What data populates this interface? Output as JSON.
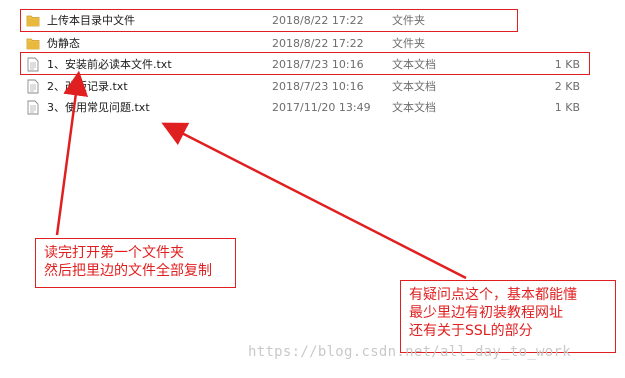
{
  "files": [
    {
      "name": "上传本目录中文件",
      "date": "2018/8/22 17:22",
      "type": "文件夹",
      "size": "",
      "icon": "folder-icon"
    },
    {
      "name": "伪静态",
      "date": "2018/8/22 17:22",
      "type": "文件夹",
      "size": "",
      "icon": "folder-icon"
    },
    {
      "name": "1、安装前必读本文件.txt",
      "date": "2018/7/23 10:16",
      "type": "文本文档",
      "size": "1 KB",
      "icon": "text-file-icon"
    },
    {
      "name": "2、改版记录.txt",
      "date": "2018/7/23 10:16",
      "type": "文本文档",
      "size": "2 KB",
      "icon": "text-file-icon"
    },
    {
      "name": "3、使用常见问题.txt",
      "date": "2017/11/20 13:49",
      "type": "文本文档",
      "size": "1 KB",
      "icon": "text-file-icon"
    }
  ],
  "annotations": {
    "note_left": {
      "line1": "读完打开第一个文件夹",
      "line2": "然后把里边的文件全部复制"
    },
    "note_right": {
      "line1": "有疑问点这个，基本都能懂",
      "line2": "最少里边有初装教程网址",
      "line3": "还有关于SSL的部分"
    }
  },
  "watermark": "https://blog.csdn.net/all_day_to_work",
  "colors": {
    "annotation": "#e02020",
    "folder": "#e8b93c",
    "secondary_text": "#6d6d6d"
  }
}
